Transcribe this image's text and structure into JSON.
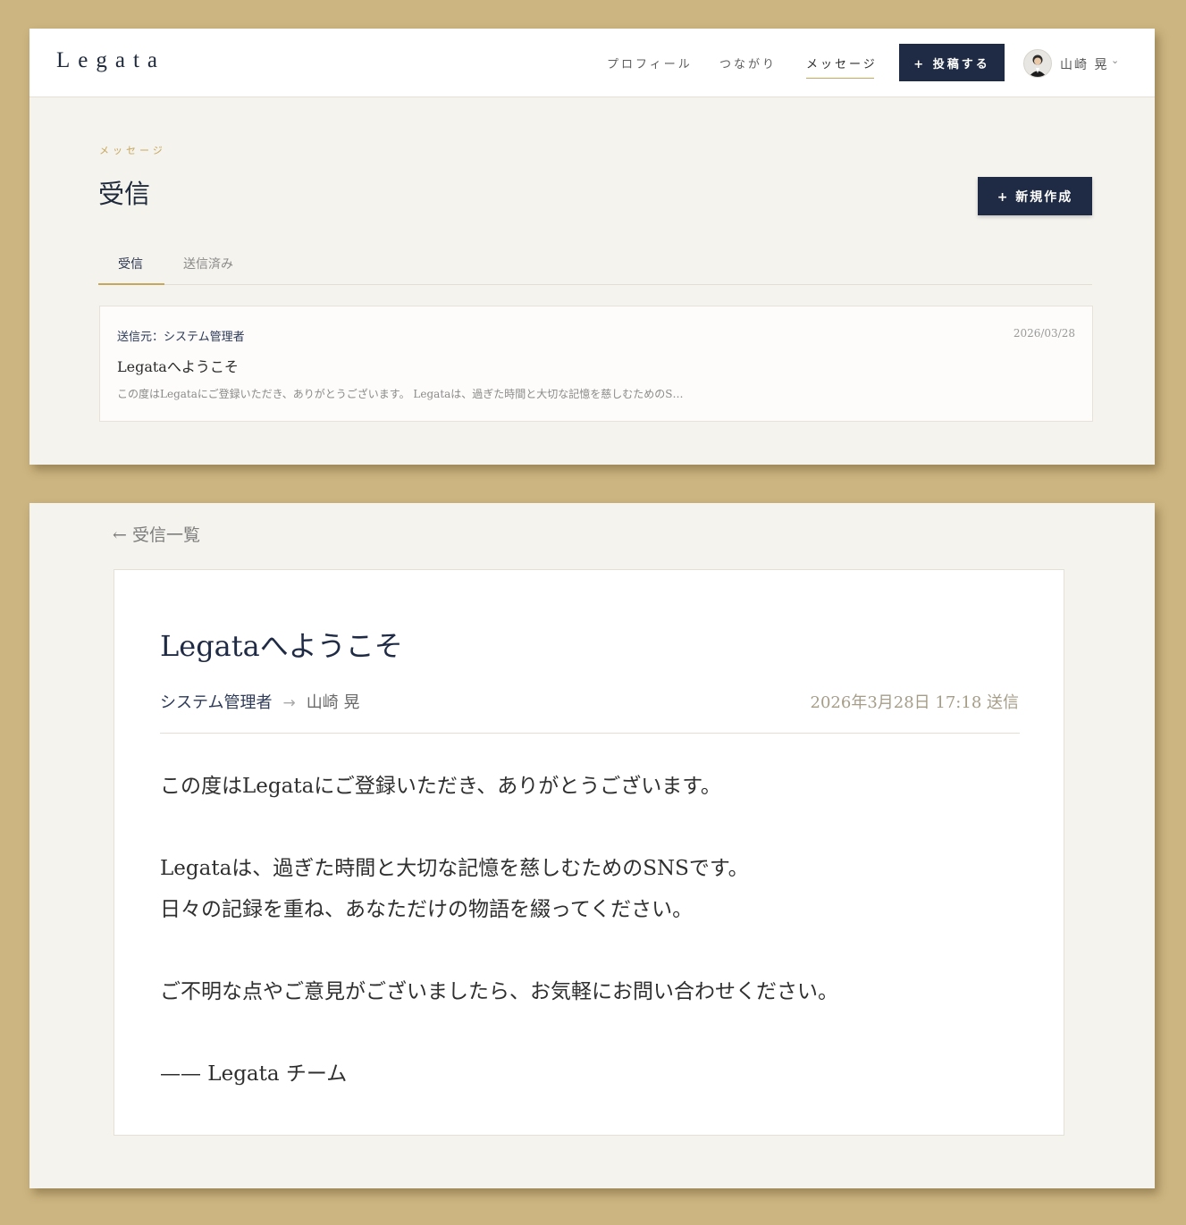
{
  "header": {
    "logo": "Legata",
    "nav": [
      "プロフィール",
      "つながり",
      "メッセージ"
    ],
    "post_button": "+ 投稿する",
    "user_name": "山崎 晃",
    "chevron": "⌄"
  },
  "inbox": {
    "eyebrow": "メッセージ",
    "title": "受信",
    "new_button": "+ 新規作成",
    "tabs": [
      "受信",
      "送信済み"
    ],
    "messages": [
      {
        "from": "送信元：システム管理者",
        "date": "2026/03/28",
        "subject": "Legataへようこそ",
        "preview": "この度はLegataにご登録いただき、ありがとうございます。 Legataは、過ぎた時間と大切な記憶を慈しむためのS…"
      }
    ]
  },
  "detail": {
    "back_link": "← 受信一覧",
    "subject": "Legataへようこそ",
    "sender": "システム管理者",
    "arrow": "→",
    "recipient": "山崎 晃",
    "sent_at": "2026年3月28日 17:18 送信",
    "body": [
      "この度はLegataにご登録いただき、ありがとうございます。",
      "Legataは、過ぎた時間と大切な記憶を慈しむためのSNSです。",
      "日々の記録を重ね、あなただけの物語を綴ってください。",
      "ご不明な点やご意見がございましたら、お気軽にお問い合わせください。",
      "—— Legata チーム"
    ]
  }
}
